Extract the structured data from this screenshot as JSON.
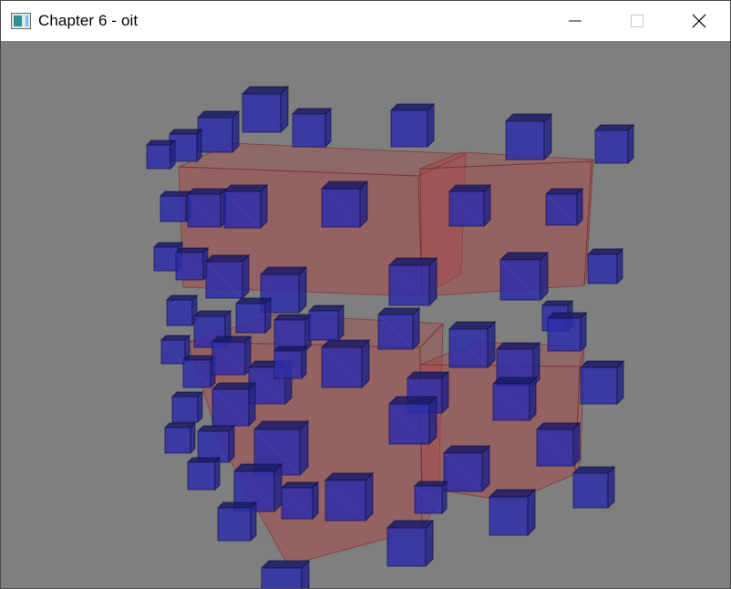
{
  "window": {
    "title": "Chapter 6 - oit",
    "icon": "app-window-icon",
    "controls": [
      {
        "name": "minimize-button",
        "icon": "minimize-icon",
        "enabled": true
      },
      {
        "name": "maximize-button",
        "icon": "maximize-icon",
        "enabled": false
      },
      {
        "name": "close-button",
        "icon": "close-icon",
        "enabled": true
      }
    ]
  },
  "scene": {
    "description_visible": false,
    "background_color": "#7f7f7f",
    "cube_color": "#2e2ea8",
    "large_cube_color": "#b04040"
  }
}
